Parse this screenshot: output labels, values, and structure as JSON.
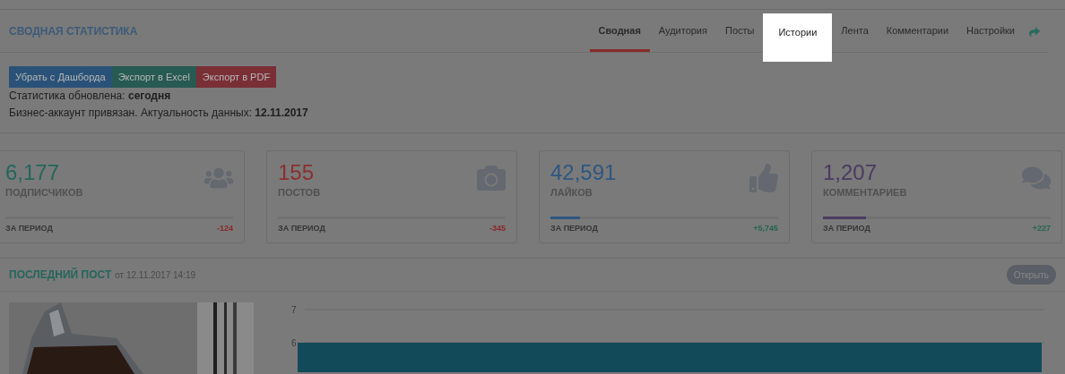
{
  "header": {
    "title": "СВОДНАЯ СТАТИСТИКА",
    "tabs": [
      {
        "label": "Сводная",
        "selected": true,
        "highlighted": false
      },
      {
        "label": "Аудитория",
        "selected": false,
        "highlighted": false
      },
      {
        "label": "Посты",
        "selected": false,
        "highlighted": false
      },
      {
        "label": "Истории",
        "selected": false,
        "highlighted": true
      },
      {
        "label": "Лента",
        "selected": false,
        "highlighted": false
      },
      {
        "label": "Комментарии",
        "selected": false,
        "highlighted": false
      },
      {
        "label": "Настройки",
        "selected": false,
        "highlighted": false
      }
    ]
  },
  "actions": [
    {
      "label": "Убрать с Дашборда",
      "color": "#2a5278"
    },
    {
      "label": "Экспорт в Excel",
      "color": "#265a52"
    },
    {
      "label": "Экспорт в PDF",
      "color": "#7a2f36"
    }
  ],
  "info": [
    "Статистика обновлена: **сегодня**",
    "Бизнес-аккаунт привязан. Актуальность данных: **12.11.2017**"
  ],
  "stats": [
    {
      "value": "6,177",
      "label": "ПОДПИСЧИКОВ",
      "kind": "users",
      "color": "#24665a",
      "level": 0,
      "period": "ЗА ПЕРИОД",
      "change": {
        "text": "-124",
        "color": "#8a2828"
      }
    },
    {
      "value": "155",
      "label": "ПОСТОВ",
      "kind": "camera",
      "color": "#8b2f2f",
      "level": 0,
      "period": "ЗА ПЕРИОД",
      "change": {
        "text": "-345",
        "color": "#8a2828"
      }
    },
    {
      "value": "42,591",
      "label": "ЛАЙКОВ",
      "kind": "like",
      "color": "#2f5680",
      "level": 0.13,
      "period": "ЗА ПЕРИОД",
      "change": {
        "text": "+5,745",
        "color": "#24664f"
      }
    },
    {
      "value": "1,207",
      "label": "КОММЕНТАРИЕВ",
      "kind": "comments",
      "color": "#4a3a60",
      "level": 0.19,
      "period": "ЗА ПЕРИОД",
      "change": {
        "text": "+227",
        "color": "#24664f"
      }
    }
  ],
  "last_post": {
    "title": "ПОСЛЕДНИЙ ПОСТ",
    "date": "от 12.11.2017 14:19",
    "open_button": "Открыть",
    "chart_axis_labels": [
      "7",
      "6"
    ]
  }
}
